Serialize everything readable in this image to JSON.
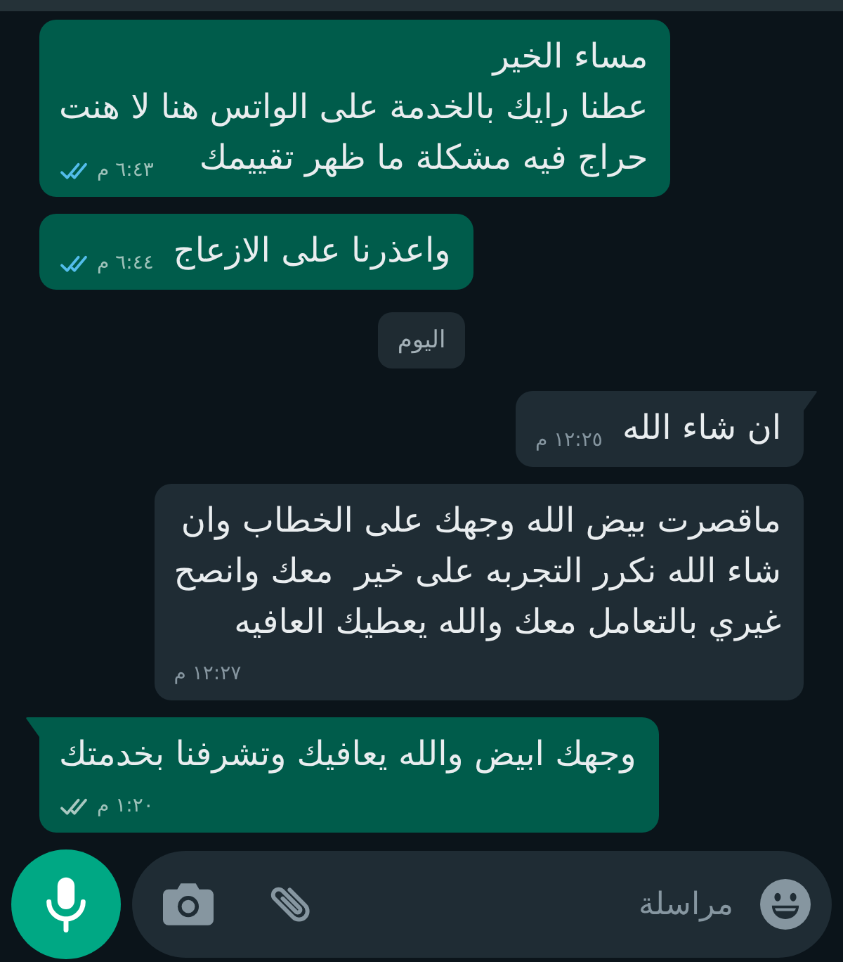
{
  "messages": [
    {
      "kind": "message",
      "outgoing": true,
      "tail": false,
      "lines": [
        "مساء الخير",
        "عطنا رايك بالخدمة على الواتس هنا لا هنت",
        "حراج فيه مشكلة ما ظهر تقييمك"
      ],
      "time": "٦:٤٣ م",
      "read": true
    },
    {
      "kind": "message",
      "outgoing": true,
      "tail": false,
      "lines": [
        "واعذرنا على الازعاج"
      ],
      "time": "٦:٤٤ م",
      "read": true
    },
    {
      "kind": "date",
      "text": "اليوم"
    },
    {
      "kind": "message",
      "outgoing": false,
      "tail": true,
      "lines": [
        "ان شاء الله"
      ],
      "time": "١٢:٢٥ م"
    },
    {
      "kind": "message",
      "outgoing": false,
      "tail": false,
      "lines": [
        "ماقصرت بيض الله وجهك على الخطاب وان",
        "شاء الله نكرر التجربه على خير  معك وانصح",
        "غيري بالتعامل معك والله يعطيك العافيه"
      ],
      "time": "١٢:٢٧ م"
    },
    {
      "kind": "message",
      "outgoing": true,
      "tail": true,
      "lines": [
        "وجهك ابيض والله يعافيك وتشرفنا بخدمتك"
      ],
      "time": "١:٢٠ م",
      "read": false
    }
  ],
  "composer": {
    "placeholder": "مراسلة"
  }
}
